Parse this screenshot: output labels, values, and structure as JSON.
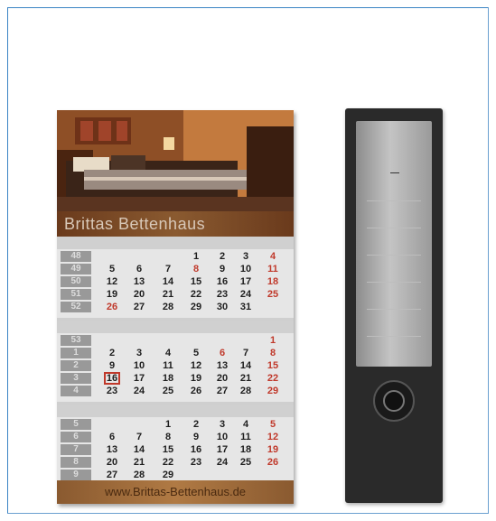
{
  "calendar": {
    "brand": "Brittas Bettenhaus",
    "footer": "www.Brittas-Bettenhaus.de"
  }
}
